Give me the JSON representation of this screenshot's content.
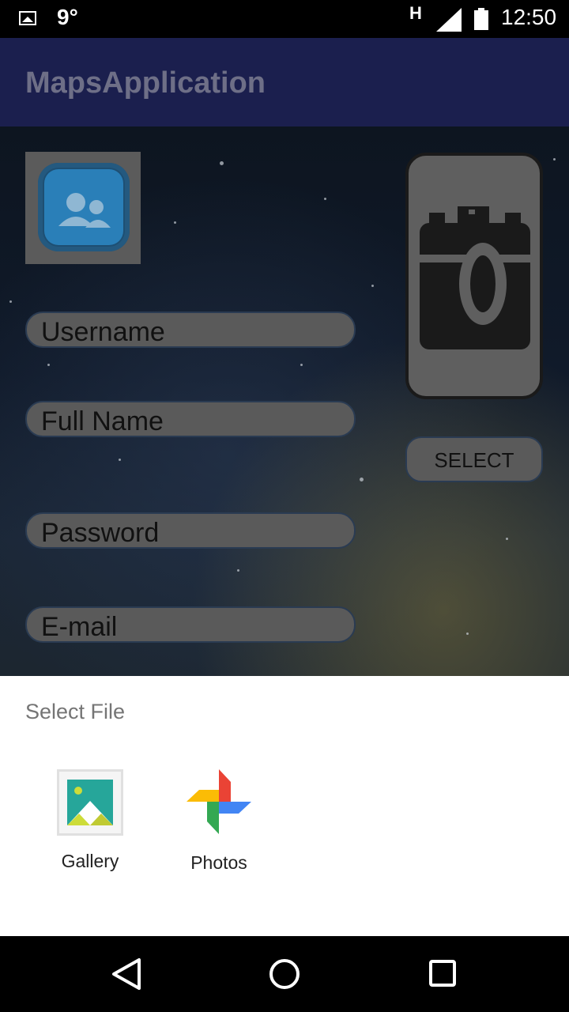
{
  "status_bar": {
    "temperature": "9°",
    "network_type": "H",
    "time": "12:50",
    "icons": [
      "image-notification-icon",
      "signal-icon",
      "battery-icon"
    ]
  },
  "app_bar": {
    "title": "MapsApplication"
  },
  "form": {
    "avatar_icon": "contacts-icon",
    "fields": {
      "username": "Username",
      "full_name": "Full Name",
      "password": "Password",
      "email": "E-mail"
    },
    "camera_icon": "camera-icon",
    "select_label": "SELECT"
  },
  "chooser": {
    "title": "Select File",
    "apps": [
      {
        "label": "Gallery",
        "icon": "gallery-icon"
      },
      {
        "label": "Photos",
        "icon": "photos-pinwheel-icon"
      }
    ]
  },
  "nav_bar": {
    "buttons": [
      "back-icon",
      "home-icon",
      "recents-icon"
    ]
  },
  "colors": {
    "app_bar": "#1b1f4e",
    "sheet": "#ffffff",
    "field_fill": "#5a5a5a"
  }
}
